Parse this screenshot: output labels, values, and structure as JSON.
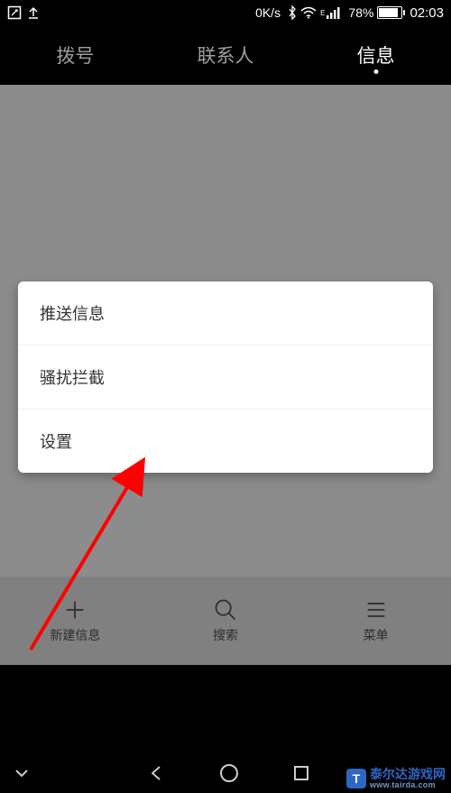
{
  "status": {
    "speed": "0K/s",
    "battery_pct": "78%",
    "time": "02:03"
  },
  "tabs": {
    "dial": "拨号",
    "contacts": "联系人",
    "messages": "信息"
  },
  "menu": {
    "push": "推送信息",
    "block": "骚扰拦截",
    "settings": "设置"
  },
  "toolbar": {
    "new_msg": "新建信息",
    "search": "搜索",
    "menu": "菜单"
  },
  "icons": {
    "compose": "compose-icon",
    "upload": "upload-icon",
    "bluetooth": "bluetooth-icon",
    "wifi": "wifi-icon",
    "signal": "signal-icon",
    "battery": "battery-icon"
  },
  "watermark": {
    "name": "泰尔达游戏网",
    "url": "www.tairda.com"
  }
}
